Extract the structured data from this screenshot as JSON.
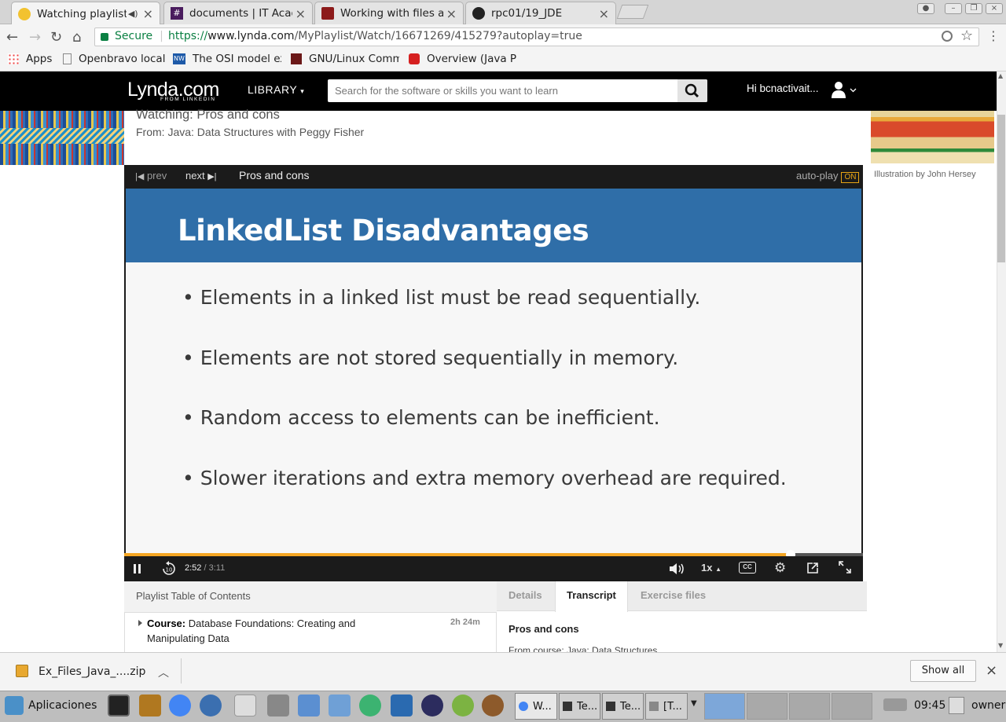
{
  "browser": {
    "tabs": [
      {
        "title": "Watching playlist:",
        "active": true
      },
      {
        "title": "documents | IT Acad"
      },
      {
        "title": "Working with files a"
      },
      {
        "title": "rpc01/19_JDE"
      }
    ],
    "secure_label": "Secure",
    "url_scheme": "https://",
    "url_domain": "www.lynda.com",
    "url_path": "/MyPlaylist/Watch/16671269/415279?autoplay=true",
    "bookmarks": [
      {
        "label": "Apps",
        "icon": "apps-grid-icon"
      },
      {
        "label": "Openbravo local",
        "icon": "page-icon"
      },
      {
        "label": "The OSI model ex",
        "icon": "nw-icon"
      },
      {
        "label": "GNU/Linux Comm",
        "icon": "c-icon"
      },
      {
        "label": "Overview (Java P",
        "icon": "oracle-icon"
      }
    ]
  },
  "header": {
    "logo_text": "Lynda.com",
    "logo_sub": "FROM LINKEDIN",
    "library_label": "LIBRARY",
    "search_placeholder": "Search for the software or skills you want to learn",
    "greeting": "Hi bcnactivait..."
  },
  "page": {
    "watching": "Watching: Pros and cons",
    "from": "From: Java: Data Structures with Peggy Fisher",
    "illustration_credit": "Illustration by John Hersey"
  },
  "player": {
    "prev_label": "prev",
    "next_label": "next",
    "video_title": "Pros and cons",
    "autoplay_label": "auto-play",
    "autoplay_state": "ON",
    "slide_title": "LinkedList Disadvantages",
    "slide_bullets": [
      "Elements in a linked list must be read sequentially.",
      "Elements are not stored sequentially in memory.",
      "Random access to elements can be inefficient.",
      "Slower iterations and extra memory overhead are required."
    ],
    "current_time": "2:52",
    "time_separator": " / ",
    "duration": "3:11",
    "progress_fraction": 0.902,
    "speed_label": "1x",
    "accent_color": "#f5a623"
  },
  "toc": {
    "title": "Playlist Table of Contents",
    "course_prefix": "Course:",
    "course_name": "Database Foundations: Creating and Manipulating Data",
    "course_duration": "2h 24m"
  },
  "details_tabs": {
    "tabs": [
      "Details",
      "Transcript",
      "Exercise files"
    ],
    "active": "Transcript",
    "transcript_title": "Pros and cons",
    "transcript_from": "From course: Java: Data Structures"
  },
  "downloads": {
    "file_name": "Ex_Files_Java_....zip",
    "show_all": "Show all"
  },
  "taskbar": {
    "apps_label": "Aplicaciones",
    "tasks": [
      "W...",
      "Te...",
      "Te...",
      "[T..."
    ],
    "clock": "09:45",
    "user": "owner"
  }
}
